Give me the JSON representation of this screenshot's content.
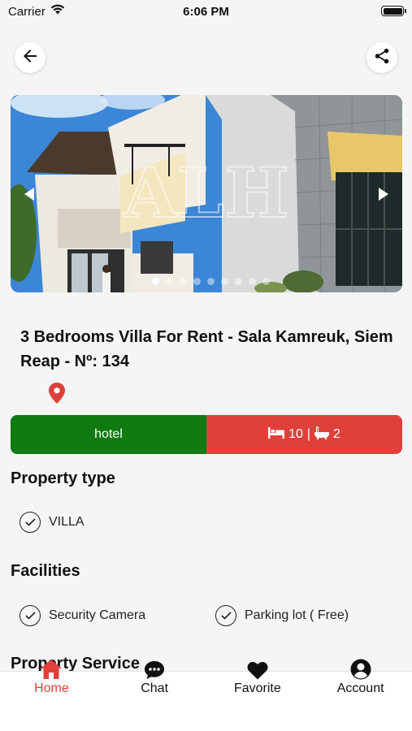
{
  "status_bar": {
    "carrier": "Carrier",
    "time": "6:06 PM"
  },
  "header": {
    "back_icon": "arrow-left-icon",
    "share_icon": "share-icon"
  },
  "carousel": {
    "image": "villa-photo",
    "watermark": "ALH",
    "total_slides": 9,
    "active_slide": 1
  },
  "listing": {
    "title": "3 Bedrooms Villa For Rent - Sala Kamreuk, Siem Reap - Nº: 134",
    "category": "hotel",
    "beds": "10",
    "separator": "|",
    "baths": "2",
    "colors": {
      "category_bg": "#117a11",
      "rooms_bg": "#e0403a",
      "accent": "#e0403a"
    }
  },
  "property_type": {
    "title": "Property type",
    "items": [
      "VILLA"
    ]
  },
  "facilities": {
    "title": "Facilities",
    "items": [
      "Security Camera",
      "Parking lot ( Free)"
    ]
  },
  "services": {
    "title": "Property Service"
  },
  "tab_bar": {
    "tabs": [
      {
        "label": "Home",
        "icon": "home-icon",
        "active": true
      },
      {
        "label": "Chat",
        "icon": "chat-icon",
        "active": false
      },
      {
        "label": "Favorite",
        "icon": "heart-icon",
        "active": false
      },
      {
        "label": "Account",
        "icon": "account-icon",
        "active": false
      }
    ]
  }
}
